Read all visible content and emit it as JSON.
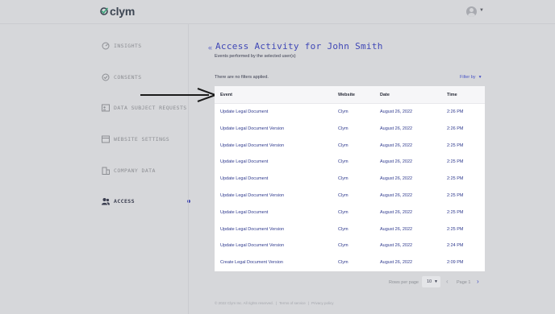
{
  "brand": {
    "name": "clym"
  },
  "sidebar": {
    "items": [
      {
        "label": "INSIGHTS",
        "icon": "gauge-icon"
      },
      {
        "label": "CONSENTS",
        "icon": "check-circle-icon"
      },
      {
        "label": "DATA SUBJECT REQUESTS",
        "icon": "id-card-icon"
      },
      {
        "label": "WEBSITE SETTINGS",
        "icon": "browser-window-icon"
      },
      {
        "label": "COMPANY DATA",
        "icon": "building-icon"
      },
      {
        "label": "ACCESS",
        "icon": "users-icon",
        "active": true
      }
    ]
  },
  "page": {
    "title": "Access  Activity for John Smith",
    "subtitle": "Events performed by the selected user(s)",
    "filter_status": "There are no filters applied.",
    "filter_by": "Filter by"
  },
  "table": {
    "columns": [
      "Event",
      "Website",
      "Date",
      "Time"
    ],
    "rows": [
      [
        "Update Legal Document",
        "Clym",
        "August 26, 2022",
        "2:26 PM"
      ],
      [
        "Update Legal Document Version",
        "Clym",
        "August 26, 2022",
        "2:26 PM"
      ],
      [
        "Update Legal Document Version",
        "Clym",
        "August 26, 2022",
        "2:25 PM"
      ],
      [
        "Update Legal Document",
        "Clym",
        "August 26, 2022",
        "2:25 PM"
      ],
      [
        "Update Legal Document",
        "Clym",
        "August 26, 2022",
        "2:25 PM"
      ],
      [
        "Update Legal Document Version",
        "Clym",
        "August 26, 2022",
        "2:25 PM"
      ],
      [
        "Update Legal Document",
        "Clym",
        "August 26, 2022",
        "2:25 PM"
      ],
      [
        "Update Legal Document Version",
        "Clym",
        "August 26, 2022",
        "2:25 PM"
      ],
      [
        "Update Legal Document Version",
        "Clym",
        "August 26, 2022",
        "2:24 PM"
      ],
      [
        "Create Legal Document Version",
        "Clym",
        "August 26, 2022",
        "2:09 PM"
      ]
    ]
  },
  "pagination": {
    "rows_per_page_label": "Rows per page",
    "rows_per_page_value": "10",
    "page_label": "Page 1"
  },
  "footer": {
    "copyright": "© 2022 Clym Inc. All rights reserved.",
    "separator": "|",
    "terms": "Terms of service",
    "privacy": "Privacy policy"
  },
  "colors": {
    "accent": "#3f47b6",
    "background": "#d6d7da",
    "table_bg": "#ffffff"
  }
}
